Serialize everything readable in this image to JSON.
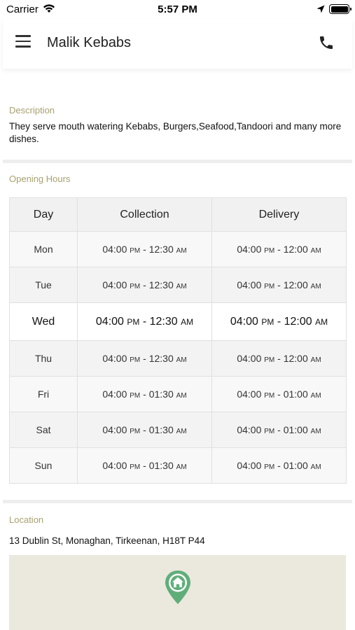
{
  "status_bar": {
    "carrier": "Carrier",
    "time": "5:57 PM"
  },
  "header": {
    "title": "Malik Kebabs",
    "menu_icon": "hamburger-menu-icon",
    "phone_icon": "phone-icon"
  },
  "description": {
    "label": "Description",
    "text": "They serve mouth watering Kebabs, Burgers,Seafood,Tandoori and many more dishes."
  },
  "opening_hours": {
    "label": "Opening Hours",
    "columns": [
      "Day",
      "Collection",
      "Delivery"
    ],
    "rows": [
      {
        "day": "Mon",
        "collection": {
          "from": "04:00",
          "from_ap": "PM",
          "to": "12:30",
          "to_ap": "AM"
        },
        "delivery": {
          "from": "04:00",
          "from_ap": "PM",
          "to": "12:00",
          "to_ap": "AM"
        }
      },
      {
        "day": "Tue",
        "collection": {
          "from": "04:00",
          "from_ap": "PM",
          "to": "12:30",
          "to_ap": "AM"
        },
        "delivery": {
          "from": "04:00",
          "from_ap": "PM",
          "to": "12:00",
          "to_ap": "AM"
        }
      },
      {
        "day": "Wed",
        "collection": {
          "from": "04:00",
          "from_ap": "PM",
          "to": "12:30",
          "to_ap": "AM"
        },
        "delivery": {
          "from": "04:00",
          "from_ap": "PM",
          "to": "12:00",
          "to_ap": "AM"
        }
      },
      {
        "day": "Thu",
        "collection": {
          "from": "04:00",
          "from_ap": "PM",
          "to": "12:30",
          "to_ap": "AM"
        },
        "delivery": {
          "from": "04:00",
          "from_ap": "PM",
          "to": "12:00",
          "to_ap": "AM"
        }
      },
      {
        "day": "Fri",
        "collection": {
          "from": "04:00",
          "from_ap": "PM",
          "to": "01:30",
          "to_ap": "AM"
        },
        "delivery": {
          "from": "04:00",
          "from_ap": "PM",
          "to": "01:00",
          "to_ap": "AM"
        }
      },
      {
        "day": "Sat",
        "collection": {
          "from": "04:00",
          "from_ap": "PM",
          "to": "01:30",
          "to_ap": "AM"
        },
        "delivery": {
          "from": "04:00",
          "from_ap": "PM",
          "to": "01:00",
          "to_ap": "AM"
        }
      },
      {
        "day": "Sun",
        "collection": {
          "from": "04:00",
          "from_ap": "PM",
          "to": "01:30",
          "to_ap": "AM"
        },
        "delivery": {
          "from": "04:00",
          "from_ap": "PM",
          "to": "01:00",
          "to_ap": "AM"
        }
      }
    ],
    "highlighted_day": "Wed"
  },
  "location": {
    "label": "Location",
    "address": "13 Dublin St, Monaghan, Tirkeenan, H18T P44",
    "pin_icon": "map-pin-home-icon"
  },
  "colors": {
    "section_label": "#a8a070",
    "map_background": "#ebe8dd",
    "pin": "#5fae7a"
  }
}
